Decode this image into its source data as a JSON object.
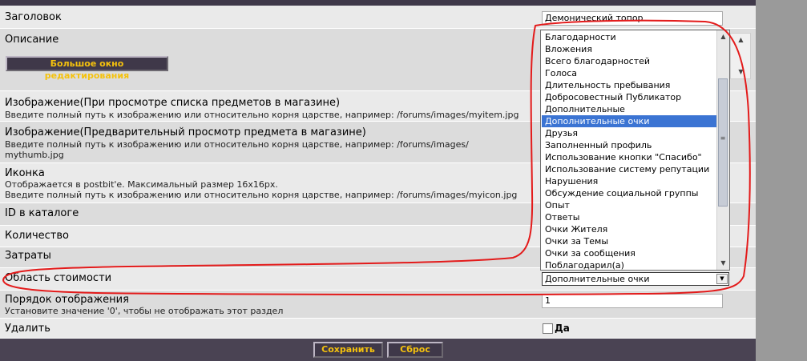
{
  "form": {
    "title": {
      "label": "Заголовок",
      "value": "Демонический топор"
    },
    "description": {
      "label": "Описание",
      "big_editor_button": "Большое окно редактирования"
    },
    "image_list": {
      "label": "Изображение(При просмотре списка предметов в магазине)",
      "desc": "Введите полный путь к изображению или относительно корня царстве, например: /forums/images/myitem.jpg"
    },
    "image_preview": {
      "label": "Изображение(Предварительный просмотр предмета в магазине)",
      "desc1": "Введите полный путь к изображению или относительно корня царстве, например: /forums/images/",
      "desc2": "mythumb.jpg"
    },
    "icon": {
      "label": "Иконка",
      "desc1": "Отображается в postbit'е. Максимальный размер 16x16px.",
      "desc2": "Введите полный путь к изображению или относительно корня царстве, например: /forums/images/myicon.jpg"
    },
    "catalog_id": {
      "label": "ID в каталоге"
    },
    "quantity": {
      "label": "Количество"
    },
    "cost": {
      "label": "Затраты"
    },
    "cost_area": {
      "label": "Область стоимости",
      "selected": "Дополнительные очки"
    },
    "display_order": {
      "label": "Порядок отображения",
      "desc": "Установите значение '0', чтобы не отображать этот раздел",
      "value": "1"
    },
    "delete": {
      "label": "Удалить",
      "checkbox_label": "Да",
      "checked": false
    }
  },
  "dropdown_options": [
    "Благодарности",
    "Вложения",
    "Всего благодарностей",
    "Голоса",
    "Длительность пребывания",
    "Добросовестный Публикатор",
    "Дополнительные",
    "Дополнительные очки",
    "Друзья",
    "Заполненный профиль",
    "Использование кнопки \"Спасибо\"",
    "Использование систему репутации",
    "Нарушения",
    "Обсуждение социальной группы",
    "Опыт",
    "Ответы",
    "Очки Жителя",
    "Очки за Темы",
    "Очки за сообщения",
    "Поблагодарил(а)"
  ],
  "dropdown_selected_index": 7,
  "footer": {
    "save_label": "Сохранить",
    "reset_label": "Сброс"
  },
  "colors": {
    "accent_text": "#f5c20d",
    "dark_bar": "#3f3849",
    "selection": "#3b74d3",
    "annotation": "#e31b1b"
  }
}
